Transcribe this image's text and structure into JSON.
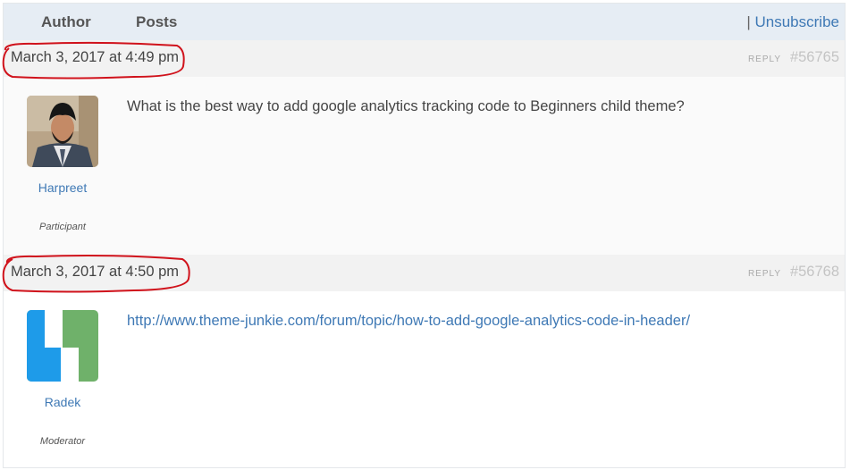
{
  "header": {
    "author_label": "Author",
    "posts_label": "Posts",
    "separator": "|",
    "unsubscribe_label": "Unsubscribe"
  },
  "replies": [
    {
      "date": "March 3, 2017 at 4:49 pm",
      "reply_label": "REPLY",
      "permalink": "#56765",
      "author_name": "Harpreet",
      "author_role": "Participant",
      "avatar_icon": "user-photo-avatar",
      "content": "What is the best way to add google analytics tracking code to Beginners child theme?"
    },
    {
      "date": "March 3, 2017 at 4:50 pm",
      "reply_label": "REPLY",
      "permalink": "#56768",
      "author_name": "Radek",
      "author_role": "Moderator",
      "avatar_icon": "blue-green-identicon-avatar",
      "content_link": "http://www.theme-junkie.com/forum/topic/how-to-add-google-analytics-code-in-header/"
    }
  ],
  "colors": {
    "annotation": "#d0121b",
    "link": "#3f79b5",
    "header_bg": "#e6edf4",
    "bar_bg": "#f2f2f2"
  }
}
